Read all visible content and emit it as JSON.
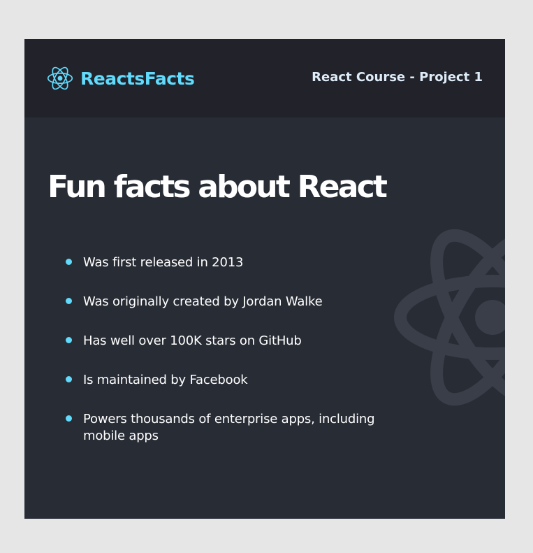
{
  "navbar": {
    "brand_icon": "react-atom-icon",
    "brand_title": "ReactsFacts",
    "subtitle": "React Course - Project 1"
  },
  "main": {
    "title": "Fun facts about React",
    "watermark_icon": "react-atom-watermark-icon",
    "facts": [
      "Was first released in 2013",
      "Was originally created by Jordan Walke",
      "Has well over 100K stars on GitHub",
      "Is maintained by Facebook",
      "Powers thousands of enterprise apps, including mobile apps"
    ]
  },
  "colors": {
    "page_background": "#e6e6e6",
    "navbar_background": "#21222a",
    "main_background": "#282c35",
    "accent": "#61dafb",
    "nav_subtitle": "#deebf8",
    "text": "#ffffff",
    "watermark": "#3a3e48"
  }
}
